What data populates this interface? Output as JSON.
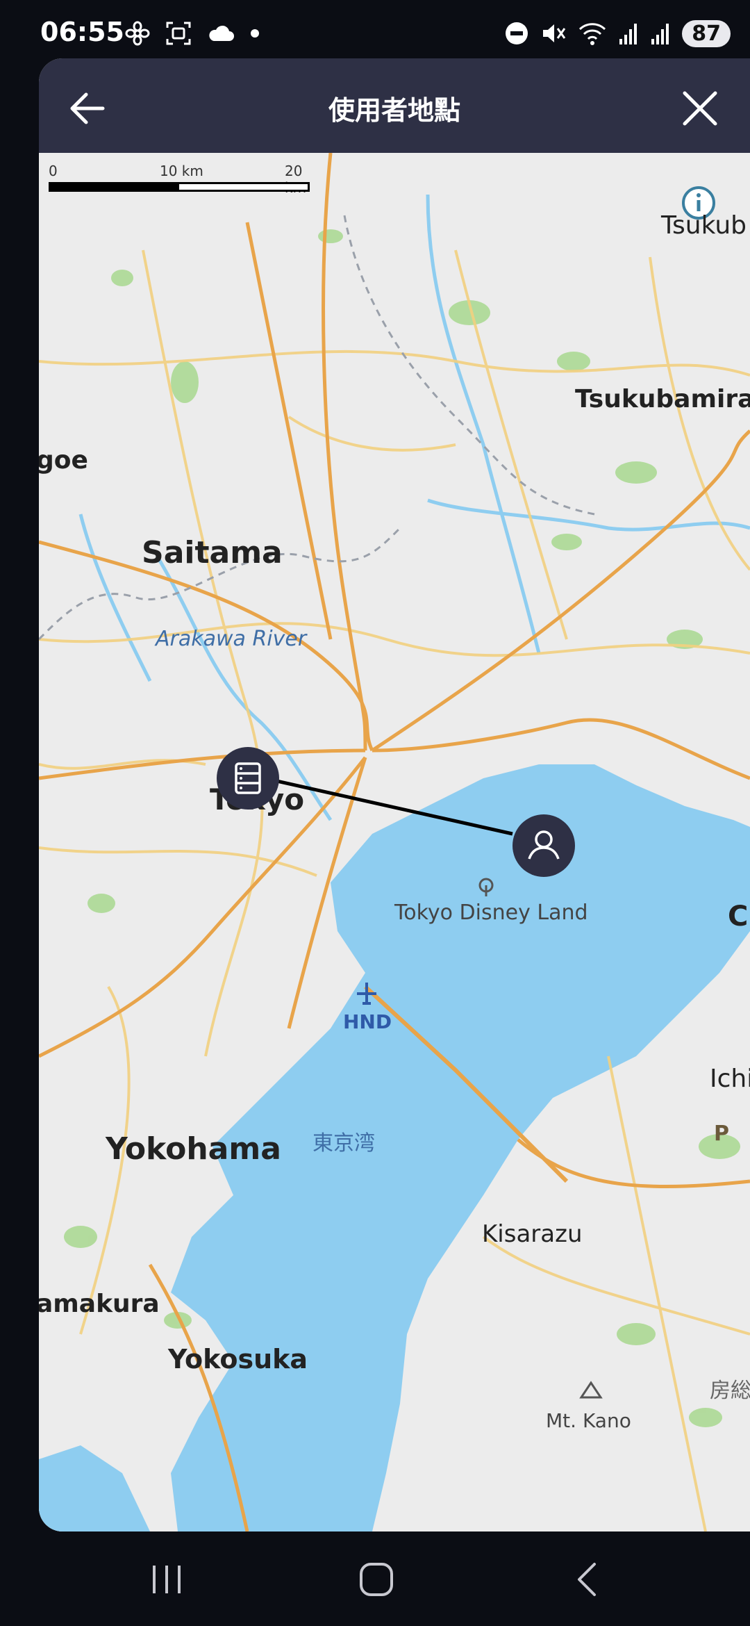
{
  "status_bar": {
    "time": "06:55",
    "battery": "87",
    "left_icons": [
      "flower-icon",
      "screenshot-icon",
      "cloud-icon",
      "dot-icon"
    ],
    "right_icons": [
      "dnd-icon",
      "mute-icon",
      "wifi-icon",
      "signal-icon",
      "signal-icon"
    ]
  },
  "header": {
    "title": "使用者地點",
    "back_icon": "arrow-left-icon",
    "close_icon": "close-icon"
  },
  "map": {
    "scale": {
      "labels": [
        "0",
        "10 km",
        "20 km"
      ]
    },
    "places": {
      "tsukuba": "Tsukub",
      "tsukubamirai": "Tsukubamira",
      "kawagoe": "goe",
      "saitama": "Saitama",
      "arakawa": "Arakawa River",
      "tokyo": "Tokyo",
      "disney": "Tokyo Disney Land",
      "c": "C",
      "hnd": "HND",
      "bay": "東京湾",
      "yokohama": "Yokohama",
      "ichi": "Ichi",
      "p": "P",
      "kisarazu": "Kisarazu",
      "kamakura": "amakura",
      "yokosuka": "Yokosuka",
      "boso": "房総",
      "mtkano": "Mt. Kano"
    },
    "markers": {
      "server_icon": "server-icon",
      "user_icon": "user-icon"
    },
    "colors": {
      "water": "#8ecdf0",
      "land": "#ececec",
      "major_road": "#e8a44a",
      "minor_road": "#f2d080",
      "park": "#a8d88f",
      "marker": "#2e3045"
    }
  },
  "nav_bar": {
    "recents_icon": "recents-icon",
    "home_icon": "home-icon",
    "back_icon": "nav-back-icon"
  }
}
